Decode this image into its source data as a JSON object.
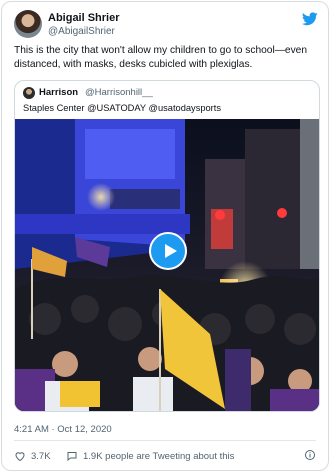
{
  "author": {
    "name": "Abigail Shrier",
    "handle": "@AbigailShrier",
    "avatar_icon": "profile-photo-avatar"
  },
  "brand_icon": "twitter-bird-icon",
  "colors": {
    "accent": "#1d9bf0",
    "text": "#0f1419",
    "muted": "#536471",
    "border": "#cfd9de"
  },
  "tweet": {
    "text": "This is the city that won't allow my children to go to school—even distanced, with masks, desks cubicled with plexiglas."
  },
  "quoted": {
    "name": "Harrison",
    "handle": "@Harrisonhill__",
    "text": "Staples Center @USATODAY @usatodaysports",
    "media": {
      "type": "video",
      "play_icon": "play-icon"
    }
  },
  "meta": {
    "timestamp": "4:21 AM · Oct 12, 2020"
  },
  "actions": {
    "likes": "3.7K",
    "talking": "1.9K people are Tweeting about this",
    "info_icon": "info-icon"
  }
}
